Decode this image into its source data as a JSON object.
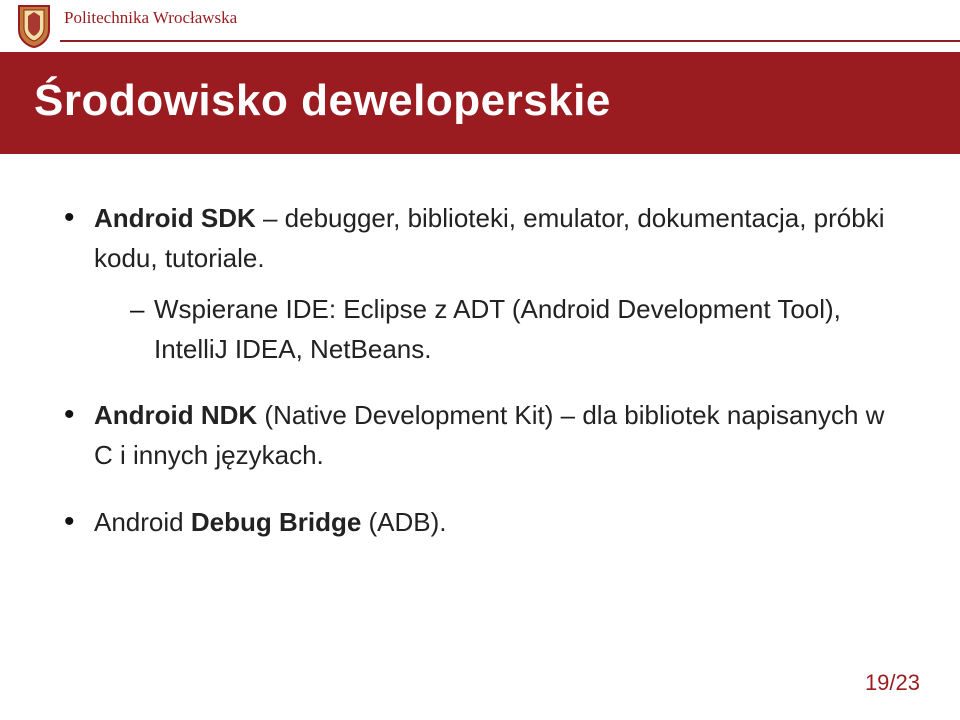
{
  "header": {
    "institution": "Politechnika Wrocławska"
  },
  "title": "Środowisko deweloperskie",
  "bullets": {
    "b1_bold": "Android SDK",
    "b1_rest": " – debugger, biblioteki, emulator, dokumentacja, próbki kodu, tutoriale.",
    "b1_sub": "Wspierane IDE: Eclipse z ADT (Android Development Tool), IntelliJ IDEA, NetBeans.",
    "b2_bold": "Android NDK",
    "b2_rest": " (Native Development Kit) – dla bibliotek napisanych w C i innych językach.",
    "b3_bold_pre": "Android ",
    "b3_bold": "Debug Bridge",
    "b3_rest": " (ADB)."
  },
  "pagination": "19/23"
}
